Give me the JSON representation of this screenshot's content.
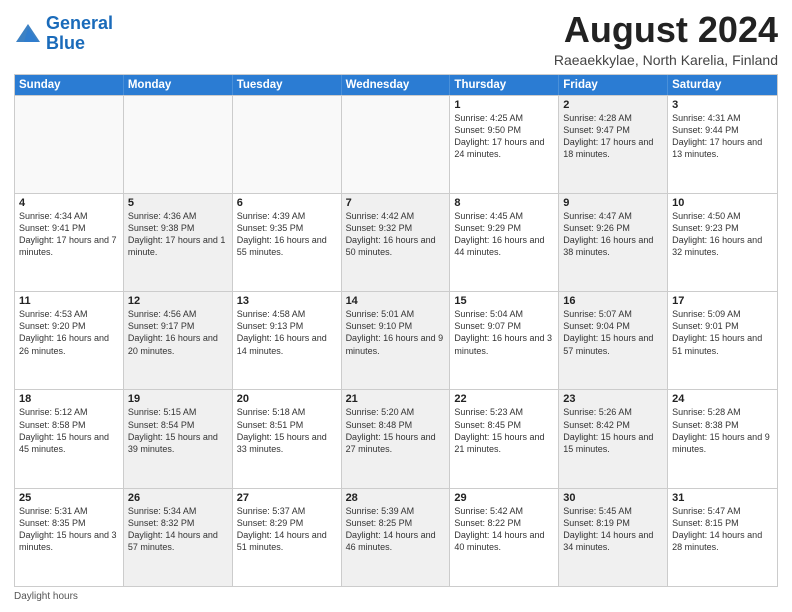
{
  "header": {
    "logo_line1": "General",
    "logo_line2": "Blue",
    "main_title": "August 2024",
    "subtitle": "Raeaekkylae, North Karelia, Finland"
  },
  "calendar": {
    "days_of_week": [
      "Sunday",
      "Monday",
      "Tuesday",
      "Wednesday",
      "Thursday",
      "Friday",
      "Saturday"
    ],
    "weeks": [
      [
        {
          "day": "",
          "info": "",
          "empty": true
        },
        {
          "day": "",
          "info": "",
          "empty": true
        },
        {
          "day": "",
          "info": "",
          "empty": true
        },
        {
          "day": "",
          "info": "",
          "empty": true
        },
        {
          "day": "1",
          "info": "Sunrise: 4:25 AM\nSunset: 9:50 PM\nDaylight: 17 hours and 24 minutes."
        },
        {
          "day": "2",
          "info": "Sunrise: 4:28 AM\nSunset: 9:47 PM\nDaylight: 17 hours and 18 minutes.",
          "shaded": true
        },
        {
          "day": "3",
          "info": "Sunrise: 4:31 AM\nSunset: 9:44 PM\nDaylight: 17 hours and 13 minutes."
        }
      ],
      [
        {
          "day": "4",
          "info": "Sunrise: 4:34 AM\nSunset: 9:41 PM\nDaylight: 17 hours and 7 minutes."
        },
        {
          "day": "5",
          "info": "Sunrise: 4:36 AM\nSunset: 9:38 PM\nDaylight: 17 hours and 1 minute.",
          "shaded": true
        },
        {
          "day": "6",
          "info": "Sunrise: 4:39 AM\nSunset: 9:35 PM\nDaylight: 16 hours and 55 minutes."
        },
        {
          "day": "7",
          "info": "Sunrise: 4:42 AM\nSunset: 9:32 PM\nDaylight: 16 hours and 50 minutes.",
          "shaded": true
        },
        {
          "day": "8",
          "info": "Sunrise: 4:45 AM\nSunset: 9:29 PM\nDaylight: 16 hours and 44 minutes."
        },
        {
          "day": "9",
          "info": "Sunrise: 4:47 AM\nSunset: 9:26 PM\nDaylight: 16 hours and 38 minutes.",
          "shaded": true
        },
        {
          "day": "10",
          "info": "Sunrise: 4:50 AM\nSunset: 9:23 PM\nDaylight: 16 hours and 32 minutes."
        }
      ],
      [
        {
          "day": "11",
          "info": "Sunrise: 4:53 AM\nSunset: 9:20 PM\nDaylight: 16 hours and 26 minutes."
        },
        {
          "day": "12",
          "info": "Sunrise: 4:56 AM\nSunset: 9:17 PM\nDaylight: 16 hours and 20 minutes.",
          "shaded": true
        },
        {
          "day": "13",
          "info": "Sunrise: 4:58 AM\nSunset: 9:13 PM\nDaylight: 16 hours and 14 minutes."
        },
        {
          "day": "14",
          "info": "Sunrise: 5:01 AM\nSunset: 9:10 PM\nDaylight: 16 hours and 9 minutes.",
          "shaded": true
        },
        {
          "day": "15",
          "info": "Sunrise: 5:04 AM\nSunset: 9:07 PM\nDaylight: 16 hours and 3 minutes."
        },
        {
          "day": "16",
          "info": "Sunrise: 5:07 AM\nSunset: 9:04 PM\nDaylight: 15 hours and 57 minutes.",
          "shaded": true
        },
        {
          "day": "17",
          "info": "Sunrise: 5:09 AM\nSunset: 9:01 PM\nDaylight: 15 hours and 51 minutes."
        }
      ],
      [
        {
          "day": "18",
          "info": "Sunrise: 5:12 AM\nSunset: 8:58 PM\nDaylight: 15 hours and 45 minutes."
        },
        {
          "day": "19",
          "info": "Sunrise: 5:15 AM\nSunset: 8:54 PM\nDaylight: 15 hours and 39 minutes.",
          "shaded": true
        },
        {
          "day": "20",
          "info": "Sunrise: 5:18 AM\nSunset: 8:51 PM\nDaylight: 15 hours and 33 minutes."
        },
        {
          "day": "21",
          "info": "Sunrise: 5:20 AM\nSunset: 8:48 PM\nDaylight: 15 hours and 27 minutes.",
          "shaded": true
        },
        {
          "day": "22",
          "info": "Sunrise: 5:23 AM\nSunset: 8:45 PM\nDaylight: 15 hours and 21 minutes."
        },
        {
          "day": "23",
          "info": "Sunrise: 5:26 AM\nSunset: 8:42 PM\nDaylight: 15 hours and 15 minutes.",
          "shaded": true
        },
        {
          "day": "24",
          "info": "Sunrise: 5:28 AM\nSunset: 8:38 PM\nDaylight: 15 hours and 9 minutes."
        }
      ],
      [
        {
          "day": "25",
          "info": "Sunrise: 5:31 AM\nSunset: 8:35 PM\nDaylight: 15 hours and 3 minutes."
        },
        {
          "day": "26",
          "info": "Sunrise: 5:34 AM\nSunset: 8:32 PM\nDaylight: 14 hours and 57 minutes.",
          "shaded": true
        },
        {
          "day": "27",
          "info": "Sunrise: 5:37 AM\nSunset: 8:29 PM\nDaylight: 14 hours and 51 minutes."
        },
        {
          "day": "28",
          "info": "Sunrise: 5:39 AM\nSunset: 8:25 PM\nDaylight: 14 hours and 46 minutes.",
          "shaded": true
        },
        {
          "day": "29",
          "info": "Sunrise: 5:42 AM\nSunset: 8:22 PM\nDaylight: 14 hours and 40 minutes."
        },
        {
          "day": "30",
          "info": "Sunrise: 5:45 AM\nSunset: 8:19 PM\nDaylight: 14 hours and 34 minutes.",
          "shaded": true
        },
        {
          "day": "31",
          "info": "Sunrise: 5:47 AM\nSunset: 8:15 PM\nDaylight: 14 hours and 28 minutes."
        }
      ]
    ]
  },
  "footer": {
    "note": "Daylight hours"
  }
}
